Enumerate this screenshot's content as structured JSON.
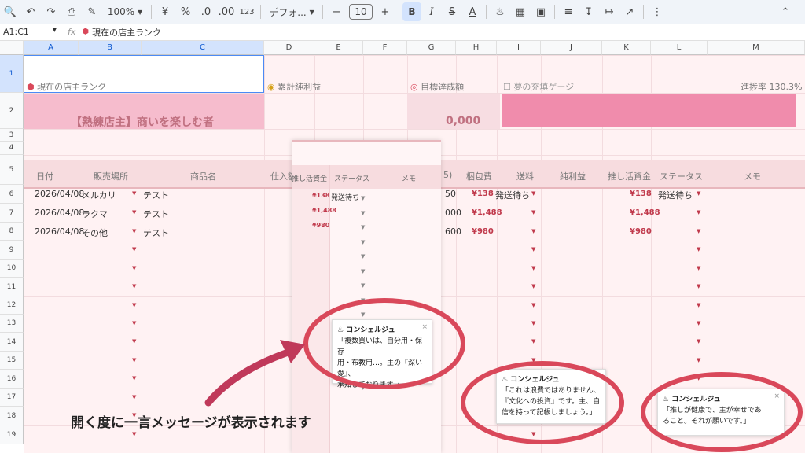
{
  "toolbar": {
    "zoom": "100%",
    "currency": "¥",
    "percent": "%",
    "dec_less": ".0",
    "dec_more": ".00",
    "num_format": "123",
    "font": "デフォ...",
    "font_size": "10"
  },
  "formula": {
    "namebox": "A1:C1",
    "fx": "fx",
    "content": "現在の店主ランク"
  },
  "columns": [
    "A",
    "B",
    "C",
    "D",
    "E",
    "F",
    "G",
    "H",
    "I",
    "J",
    "K",
    "L",
    "M"
  ],
  "rows": [
    "1",
    "2",
    "3",
    "4",
    "5",
    "6",
    "7",
    "8",
    "9",
    "10",
    "11",
    "12",
    "13",
    "14",
    "15",
    "16",
    "17",
    "18",
    "19"
  ],
  "top": {
    "rank_label": "現在の店主ランク",
    "rank_value": "【熟練店主】商いを楽しむ者",
    "profit_label": "累計純利益",
    "goal_label": "目標達成額",
    "goal_value": "0,000",
    "dream_label": "夢の充填ゲージ",
    "progress_label": "進捗率 130.3%"
  },
  "header": {
    "date": "日付",
    "shop": "販売場所",
    "item": "商品名",
    "purchase": "仕入額",
    "pack": "梱包費",
    "shipping": "送料",
    "net": "純利益",
    "oshi": "推し活資金",
    "status": "ステータス",
    "memo": "メモ",
    "partial_g": "5)",
    "partial_i": "ス"
  },
  "data_rows": [
    {
      "date": "2026/04/08",
      "shop": "メルカリ",
      "item": "テスト",
      "g": "50",
      "pack": "¥138",
      "status": "発送待ち",
      "oshi": "¥138",
      "status2": "発送待ち"
    },
    {
      "date": "2026/04/08",
      "shop": "ラクマ",
      "item": "テスト",
      "g": "000",
      "pack": "¥1,488",
      "status": "",
      "oshi": "¥1,488",
      "status2": ""
    },
    {
      "date": "2026/04/08",
      "shop": "その他",
      "item": "テスト",
      "g": "600",
      "pack": "¥980",
      "status": "",
      "oshi": "¥980",
      "status2": ""
    }
  ],
  "panel": {
    "h_oshi": "推し活資金",
    "h_status": "ステータス",
    "h_memo": "メモ",
    "rows": [
      {
        "oshi": "¥138",
        "status": "発送待ち"
      },
      {
        "oshi": "¥1,488",
        "status": ""
      },
      {
        "oshi": "¥980",
        "status": ""
      }
    ]
  },
  "popups": [
    {
      "title": "コンシェルジュ",
      "body": "「複数買いは、自分用・保存\n用・布教用…。主の『深い愛』、\n承知しております。」",
      "close": "×"
    },
    {
      "title": "コンシェルジュ",
      "body": "「これは浪費ではありません、\n『文化への投資』です。主、自\n信を持って記帳しましょう。」",
      "close": "×"
    },
    {
      "title": "コンシェルジュ",
      "body": "「推しが健康で、主が幸せであ\nること。それが願いです。」",
      "close": "×"
    }
  ],
  "annotation": "開く度に一言メッセージが表示されます",
  "colors": {
    "accent": "#d9485a",
    "pink_header": "#f6bccd",
    "gauge": "#f08cac"
  }
}
